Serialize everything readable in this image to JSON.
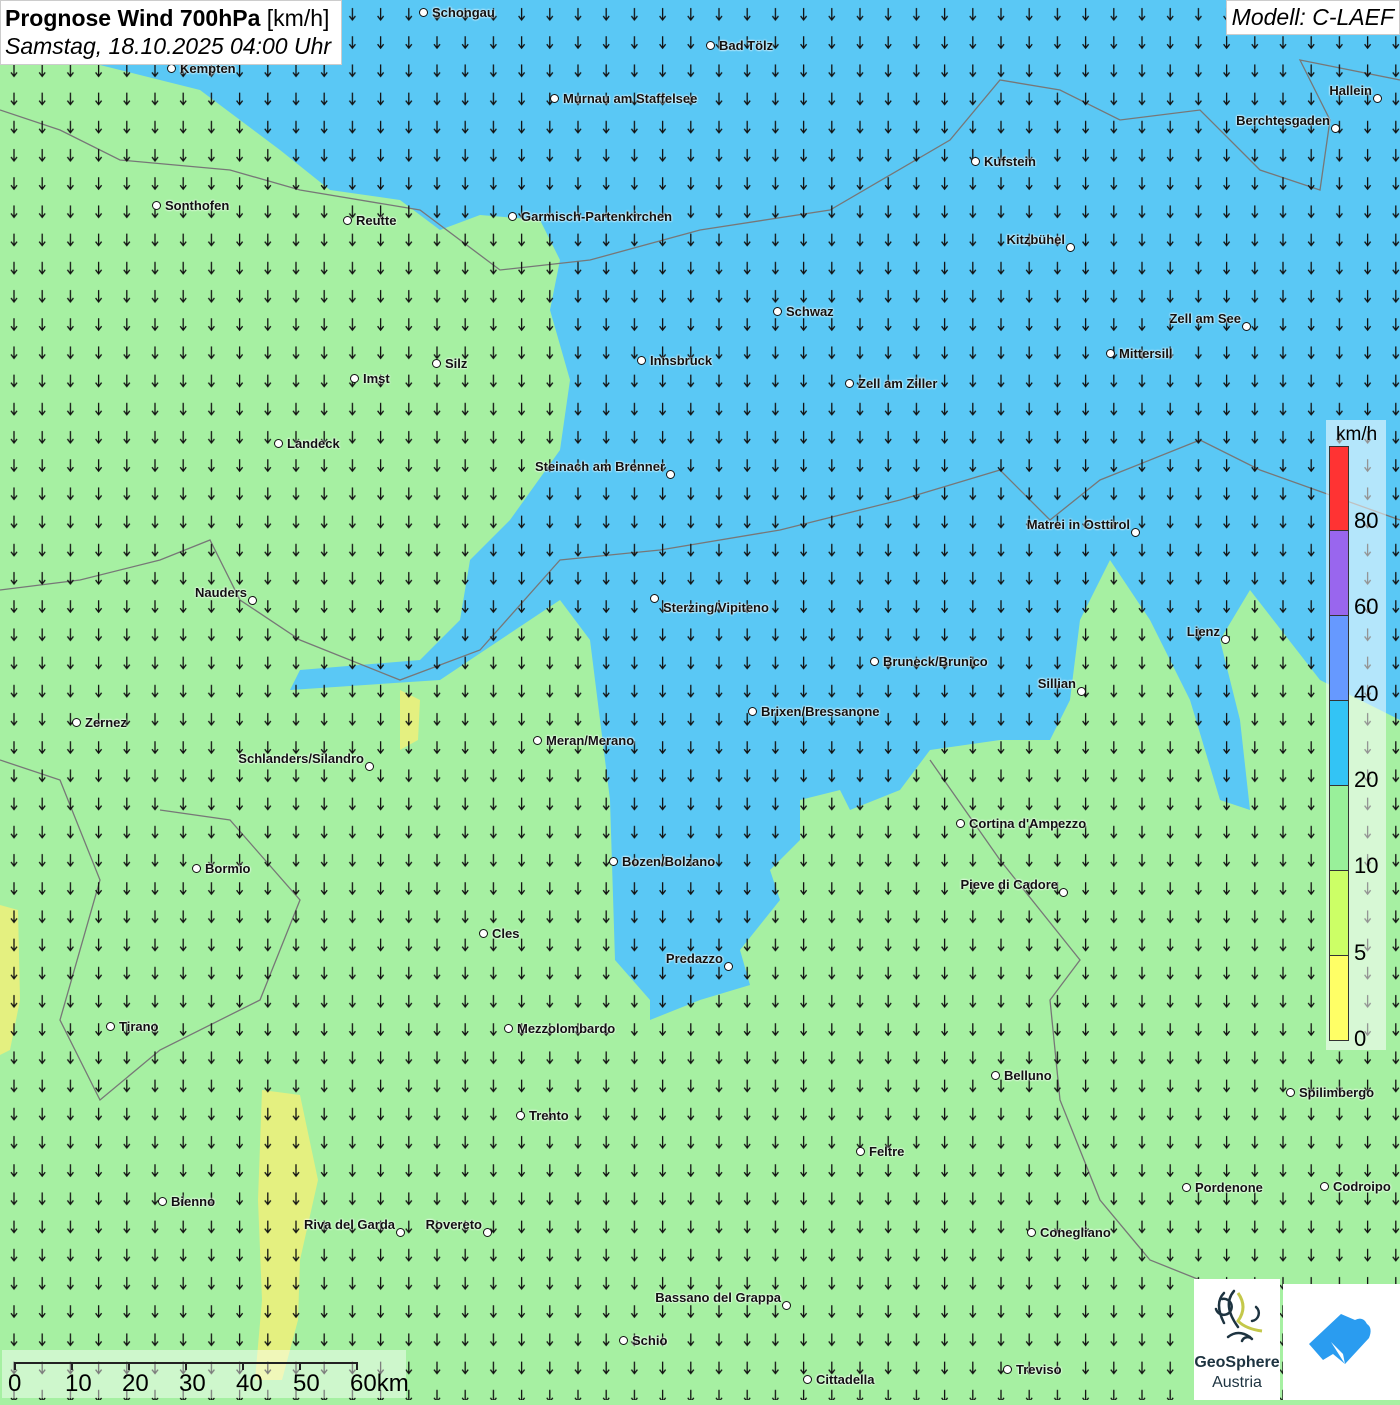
{
  "header": {
    "title": "Prognose Wind 700hPa",
    "unit": "[km/h]",
    "datetime": "Samstag, 18.10.2025 04:00 Uhr",
    "model": "Modell: C-LAEF"
  },
  "legend": {
    "unit": "km/h",
    "labels": [
      "80",
      "60",
      "40",
      "20",
      "10",
      "5",
      "0"
    ],
    "colors": [
      "#ff3333",
      "#9966ee",
      "#6699ff",
      "#33c4f5",
      "#99f09a",
      "#ccff66",
      "#ffff66"
    ]
  },
  "scale_bar": {
    "labels": [
      "0",
      "10",
      "20",
      "30",
      "40",
      "50",
      "60km"
    ]
  },
  "colors": {
    "land_low": "#a6f0a2",
    "wind_20_40": "#5ac8f5",
    "wind_0_5": "#f0f07a"
  },
  "cities": [
    "Schongau",
    "Bad Tölz",
    "Kempten",
    "Murnau am Staffelsee",
    "Hallein",
    "Berchtesgaden",
    "Kufstein",
    "Sonthofen",
    "Reutte",
    "Garmisch-Partenkirchen",
    "Kitzbühel",
    "Schwaz",
    "Zell am See",
    "Innsbruck",
    "Mittersill",
    "Silz",
    "Imst",
    "Zell am Ziller",
    "Landeck",
    "Steinach am Brenner",
    "Matrei in Osttirol",
    "Nauders",
    "Sterzing/Vipiteno",
    "Lienz",
    "Bruneck/Brunico",
    "Sillian",
    "Zernez",
    "Brixen/Bressanone",
    "Meran/Merano",
    "Schlanders/Silandro",
    "Cortina d'Ampezzo",
    "Bozen/Bolzano",
    "Bormio",
    "Pieve di Cadore",
    "Cles",
    "Predazzo",
    "Tirano",
    "Mezzolombardo",
    "Belluno",
    "Spilimbergo",
    "Trento",
    "Feltre",
    "Codroipo",
    "Pordenone",
    "Bienno",
    "Riva del Garda",
    "Rovereto",
    "Conegliano",
    "Bassano del Grappa",
    "Schio",
    "Treviso",
    "Cittadella"
  ],
  "logos": {
    "geosphere_line1": "GeoSphere",
    "geosphere_line2": "Austria"
  }
}
